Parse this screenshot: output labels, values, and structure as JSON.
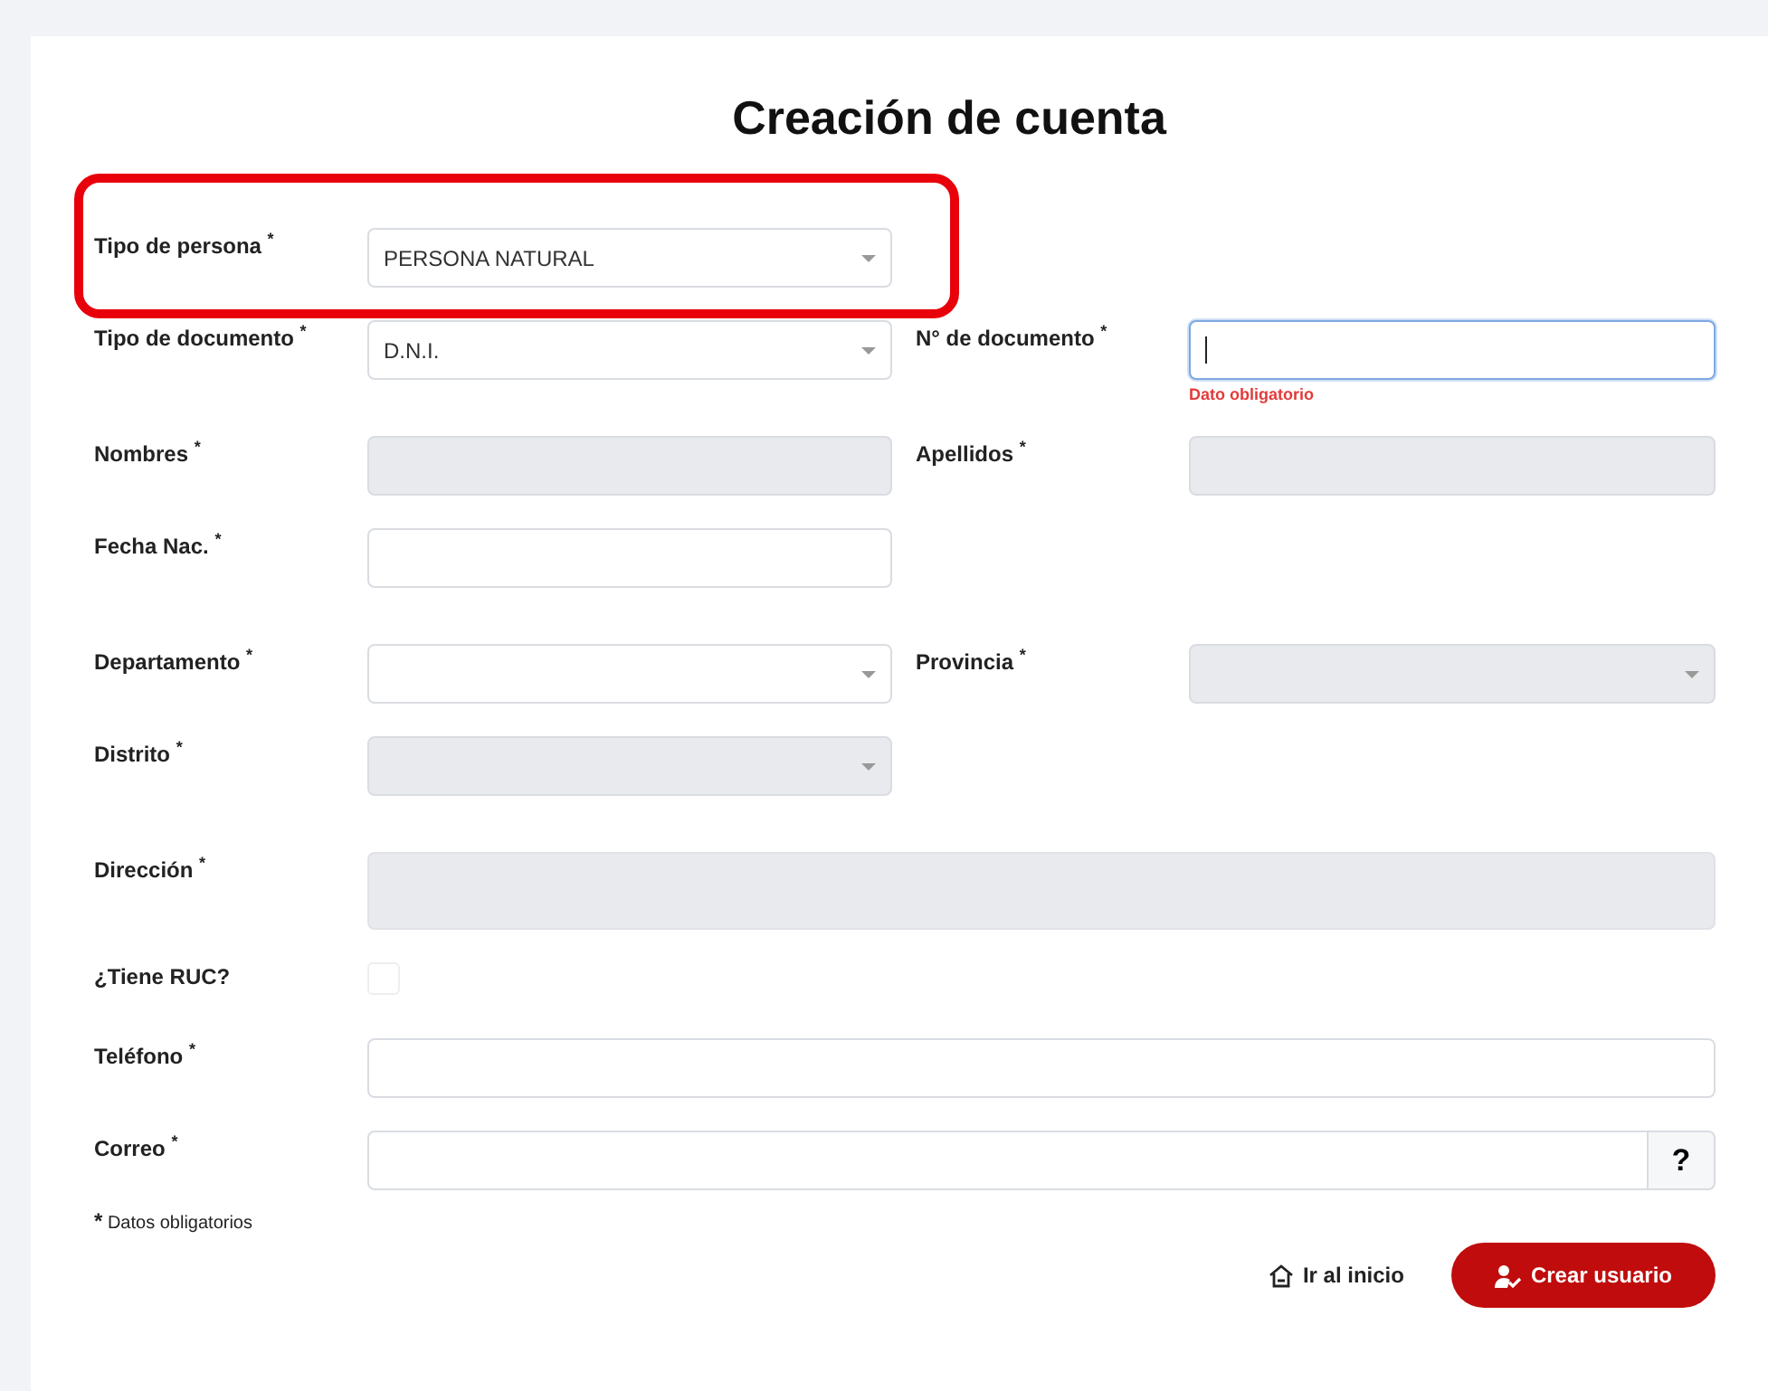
{
  "title": "Creación de cuenta",
  "rows": [
    {
      "highlighted": true,
      "fields": [
        {
          "kind": "select",
          "label": "Tipo de persona $^{*}$",
          "value": "PERSONA NATURAL",
          "disabled": false
        }
      ]
    },
    {
      "highlighted": false,
      "fields": [
        {
          "kind": "select",
          "label": "Tipo de documento $^{*}$",
          "value": "D.N.I.",
          "disabled": false
        },
        {
          "kind": "text",
          "label": "N° de documento $^{*}$",
          "focused": true,
          "disabled": false,
          "error": "Dato obligatorio"
        }
      ]
    },
    {
      "highlighted": false,
      "fields": [
        {
          "kind": "text",
          "label": "Nombres $^{*}$",
          "disabled": true
        },
        {
          "kind": "text",
          "label": "Apellidos $^{*}$",
          "disabled": true
        }
      ]
    },
    {
      "highlighted": false,
      "fields": [
        {
          "kind": "text",
          "label": "Fecha Nac. $^{*}$",
          "disabled": false
        }
      ]
    },
    {
      "highlighted": false,
      "fields": [
        {
          "kind": "select",
          "label": "Departamento $^{*}$",
          "disabled": false
        },
        {
          "kind": "select",
          "label": "Provincia $^{*}$",
          "disabled": true
        }
      ]
    },
    {
      "highlighted": false,
      "fields": [
        {
          "kind": "select",
          "label": "Distrito $^{*}$",
          "disabled": true
        }
      ]
    },
    {
      "highlighted": false,
      "fields": [
        {
          "kind": "textarea",
          "label": "Dirección $^{*}$",
          "disabled": true
        }
      ]
    },
    {
      "highlighted": false,
      "fields": [
        {
          "kind": "checkbox",
          "label": "¿Tiene RUC?",
          "checked": false
        }
      ]
    },
    {
      "highlighted": false,
      "fields": [
        {
          "kind": "wide",
          "label": "Teléfono $^{*}$",
          "disabled": false
        }
      ]
    },
    {
      "highlighted": false,
      "fields": [
        {
          "kind": "help",
          "label": "Correo $^{*}$",
          "disabled": false,
          "help": "?"
        }
      ]
    }
  ],
  "note": {
    "mark": "*",
    "text": "Datos obligatorios"
  },
  "buttons": {
    "home": "Ir al inicio",
    "create": "Crear usuario"
  }
}
